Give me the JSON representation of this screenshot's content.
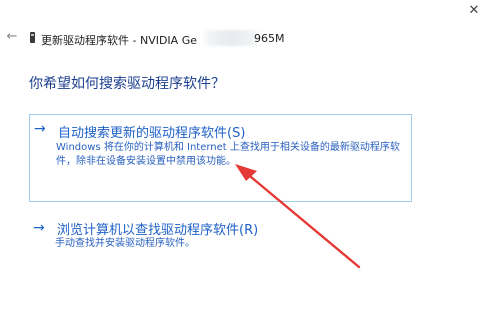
{
  "titlebar": {
    "close_glyph": "✕",
    "close_icon": "close-icon"
  },
  "nav": {
    "back_glyph": "←",
    "back_icon": "back-arrow-icon",
    "device_icon": "graphics-card-icon",
    "title": "更新驱动程序软件 - NVIDIA Ge",
    "title_suffix": "965M"
  },
  "main": {
    "question": "你希望如何搜索驱动程序软件？",
    "options": [
      {
        "arrow": "→",
        "title": "自动搜索更新的驱动程序软件(S)",
        "desc": "Windows 将在你的计算机和 Internet 上查找用于相关设备的最新驱动程序软件，除非在设备安装设置中禁用该功能。"
      },
      {
        "arrow": "→",
        "title": "浏览计算机以查找驱动程序软件(R)",
        "desc": "手动查找并安装驱动程序软件。"
      }
    ]
  },
  "colors": {
    "link_blue": "#1e61c8",
    "heading_blue": "#1b3f8f",
    "highlight_border": "#9ecbf0",
    "annotation_red": "#e53935"
  }
}
